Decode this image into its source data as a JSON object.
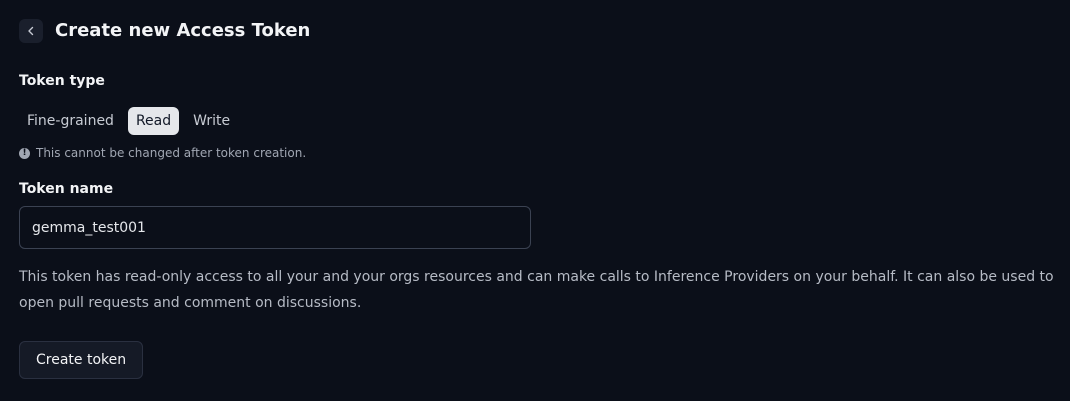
{
  "header": {
    "title": "Create new Access Token",
    "back_icon": "chevron-left-icon"
  },
  "token_type": {
    "label": "Token type",
    "tabs": [
      {
        "label": "Fine-grained",
        "active": false
      },
      {
        "label": "Read",
        "active": true
      },
      {
        "label": "Write",
        "active": false
      }
    ],
    "hint_icon": "info-icon",
    "hint": "This cannot be changed after token creation."
  },
  "token_name": {
    "label": "Token name",
    "value": "gemma_test001"
  },
  "description": "This token has read-only access to all your and your orgs resources and can make calls to Inference Providers on your behalf. It can also be used to open pull requests and comment on discussions.",
  "actions": {
    "create_label": "Create token"
  },
  "colors": {
    "background": "#0b0f19",
    "active_tab": "#e5e7eb"
  }
}
